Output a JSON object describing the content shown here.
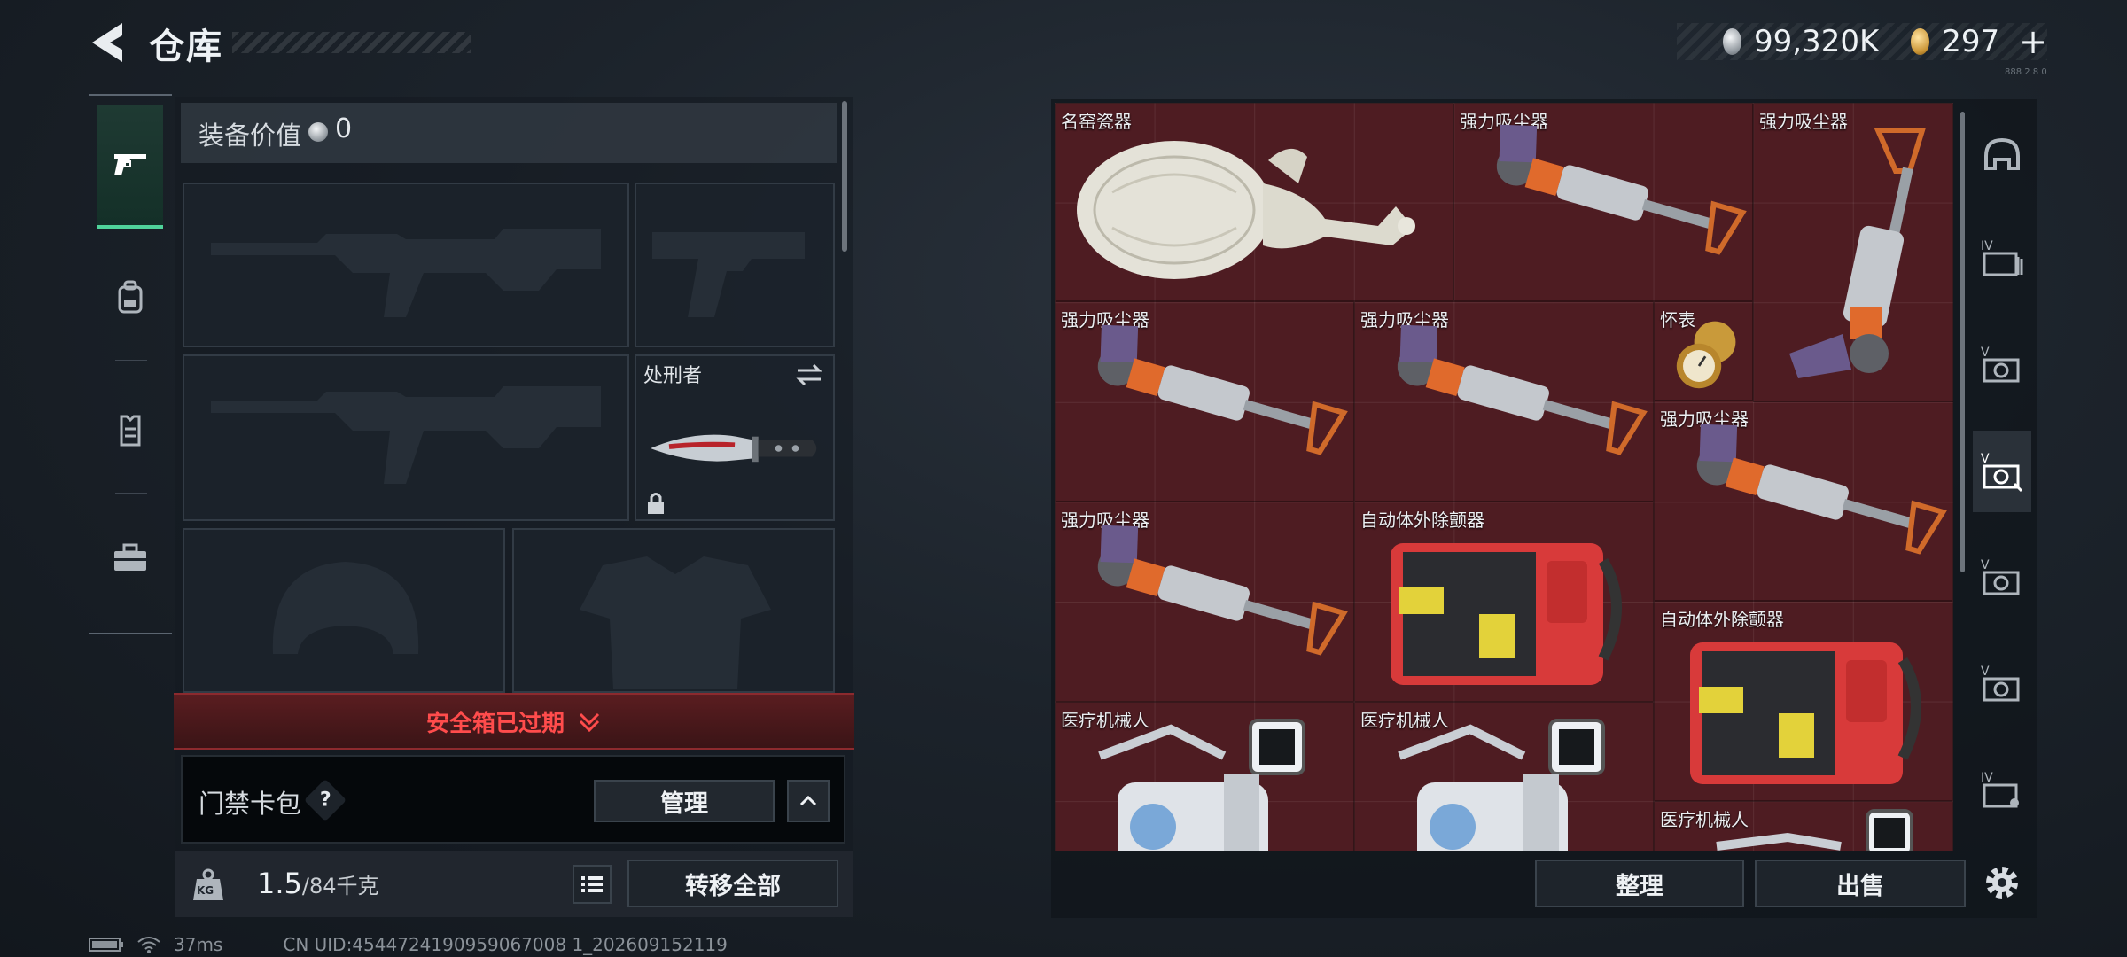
{
  "header": {
    "title": "仓库",
    "currencies": [
      {
        "icon": "silver-coin-icon",
        "value": "99,320K"
      },
      {
        "icon": "gold-coin-icon",
        "value": "297"
      }
    ],
    "plus_label": "+",
    "tiny_code": "888 2 8 0"
  },
  "left_tabs": [
    {
      "icon": "pistol-icon",
      "active": true
    },
    {
      "icon": "backpack-icon",
      "active": false
    },
    {
      "icon": "vest-icon",
      "active": false
    },
    {
      "icon": "toolbox-icon",
      "active": false
    }
  ],
  "equipment": {
    "value_label": "装备价值",
    "value": "0",
    "melee_name": "处刑者",
    "safebox_status": "安全箱已过期",
    "keycard_label": "门禁卡包",
    "keycard_help": "?",
    "manage_label": "管理",
    "weight_current": "1.5",
    "weight_max": "/84千克",
    "kg_label": "KG",
    "transfer_all_label": "转移全部"
  },
  "stash": {
    "items": [
      {
        "name": "名窑瓷器",
        "kind": "vase"
      },
      {
        "name": "强力吸尘器",
        "kind": "vacuum"
      },
      {
        "name": "强力吸尘器",
        "kind": "vacuum-vertical"
      },
      {
        "name": "强力吸尘器",
        "kind": "vacuum"
      },
      {
        "name": "强力吸尘器",
        "kind": "vacuum"
      },
      {
        "name": "怀表",
        "kind": "pocket-watch"
      },
      {
        "name": "强力吸尘器",
        "kind": "vacuum"
      },
      {
        "name": "强力吸尘器",
        "kind": "vacuum"
      },
      {
        "name": "自动体外除颤器",
        "kind": "aed"
      },
      {
        "name": "自动体外除颤器",
        "kind": "aed"
      },
      {
        "name": "医疗机械人",
        "kind": "robot"
      },
      {
        "name": "医疗机械人",
        "kind": "robot"
      },
      {
        "name": "医疗机械人",
        "kind": "robot"
      }
    ],
    "sort_label": "整理",
    "sell_label": "出售"
  },
  "right_tabs": [
    {
      "icon": "helmet-icon",
      "label": ""
    },
    {
      "icon": "storage-iv-icon",
      "label": "IV"
    },
    {
      "icon": "storage-v-icon",
      "label": "V"
    },
    {
      "icon": "storage-v-active-icon",
      "label": "V",
      "active": true
    },
    {
      "icon": "storage-v-icon",
      "label": "V"
    },
    {
      "icon": "storage-v-icon",
      "label": "V"
    },
    {
      "icon": "storage-iv-icon",
      "label": "IV"
    }
  ],
  "status_bar": {
    "ping": "37ms",
    "uid": "CN UID:4544724190959067008 1_202609152119"
  },
  "colors": {
    "accent_green": "#4fd39a",
    "stash_bg": "#4e1c22",
    "warning_red": "#ff4c4c"
  }
}
